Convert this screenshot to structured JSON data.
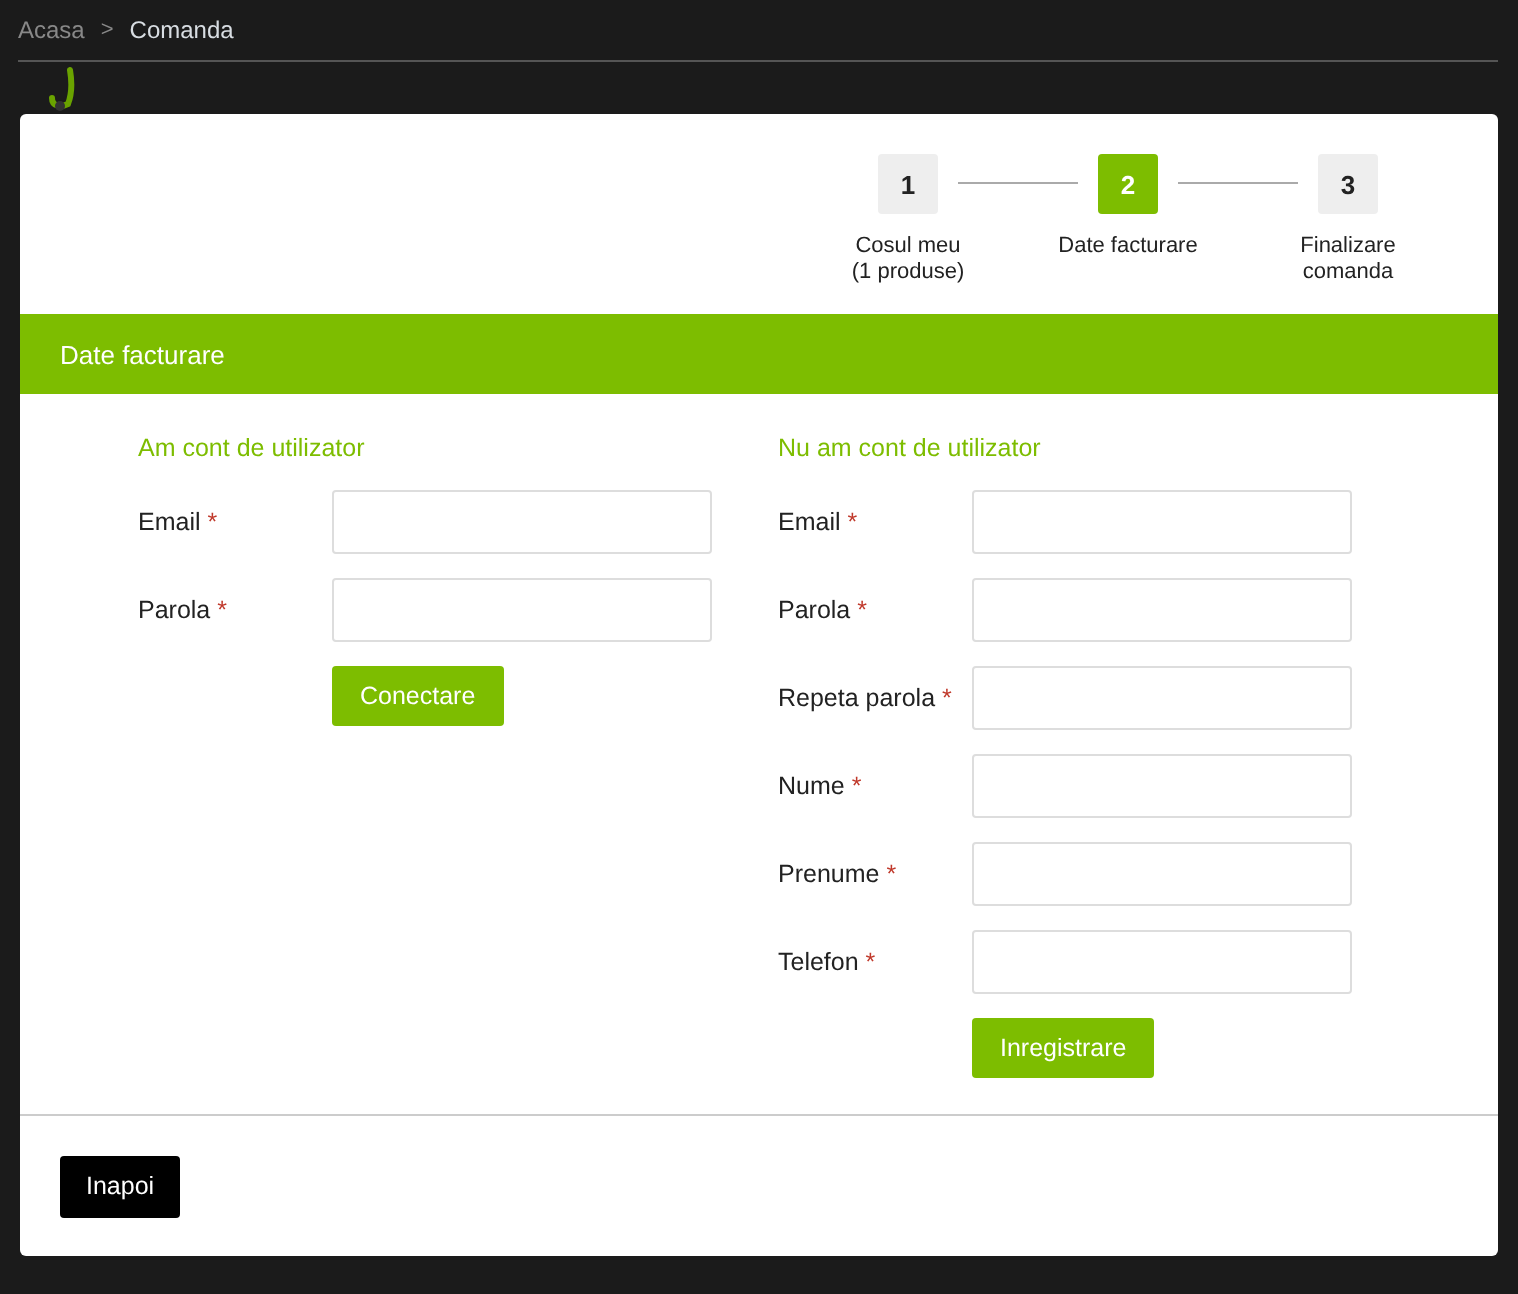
{
  "breadcrumb": {
    "items": [
      {
        "label": "Acasa",
        "selected": false
      },
      {
        "label": "Comanda",
        "selected": true
      }
    ],
    "separator": ">"
  },
  "steps": [
    {
      "number": "1",
      "lines": [
        "Cosul meu",
        "(1 produse)"
      ],
      "selected": false
    },
    {
      "number": "2",
      "lines": [
        "Date facturare"
      ],
      "selected": true
    },
    {
      "number": "3",
      "lines": [
        "Finalizare",
        "comanda"
      ],
      "selected": false
    }
  ],
  "section_title": "Date facturare",
  "columns": [
    {
      "heading": "Am cont de utilizator",
      "fields": [
        {
          "label": "Email",
          "mark": "*"
        },
        {
          "label": "Parola",
          "mark": "*"
        }
      ],
      "button": "Conectare"
    },
    {
      "heading": "Nu am cont de utilizator",
      "fields": [
        {
          "label": "Email",
          "mark": "*"
        },
        {
          "label": "Parola",
          "mark": "*"
        },
        {
          "label": "Repeta parola",
          "mark": "*"
        },
        {
          "label": "Nume",
          "mark": "*"
        },
        {
          "label": "Prenume",
          "mark": "*"
        },
        {
          "label": "Telefon",
          "mark": "*"
        }
      ],
      "button": "Inregistrare"
    }
  ],
  "back_button": "Inapoi"
}
